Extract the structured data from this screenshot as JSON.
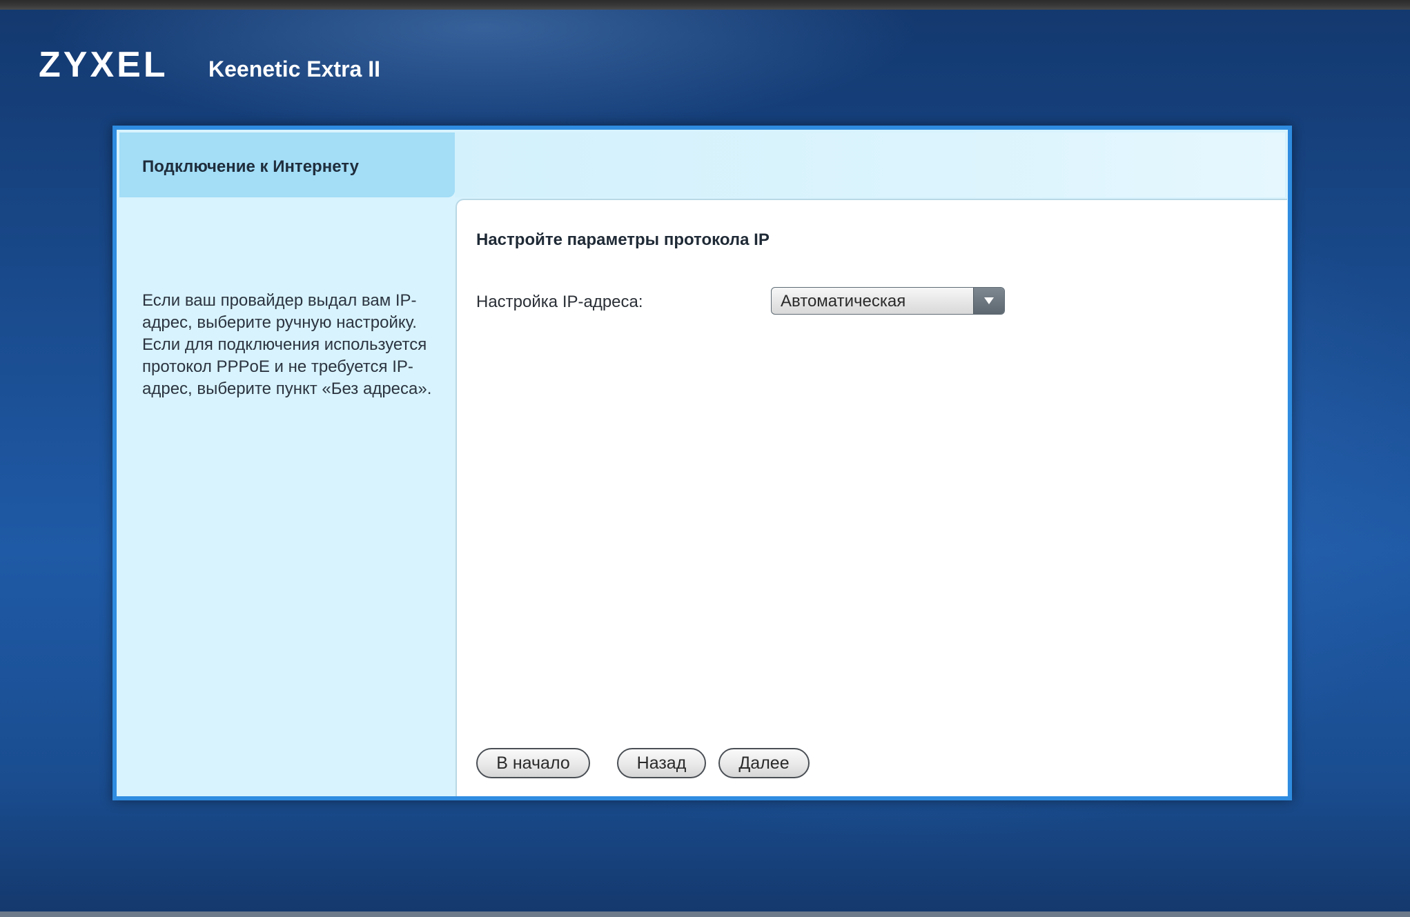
{
  "header": {
    "brand": "ZYXEL",
    "model": "Keenetic Extra II"
  },
  "sidebar": {
    "title": "Подключение к Интернету",
    "help_text": "Если ваш провайдер выдал вам IP-адрес, выберите ручную настройку. Если для подключения используется протокол PPPoE и не требуется IP-адрес, выберите пункт «Без адреса»."
  },
  "main": {
    "section_title": "Настройте параметры протокола IP",
    "ip_setting_label": "Настройка IP-адреса:",
    "ip_setting_value": "Автоматическая",
    "dropdown_icon": "triangle-down-icon"
  },
  "buttons": {
    "home": "В начало",
    "back": "Назад",
    "next": "Далее"
  },
  "colors": {
    "background": "#1a4c8f",
    "panel_border": "#2f8ce0",
    "sidebar_bg": "#d8f3fd",
    "sidebar_tab": "#a3ddf6",
    "content_bg": "#ffffff"
  }
}
